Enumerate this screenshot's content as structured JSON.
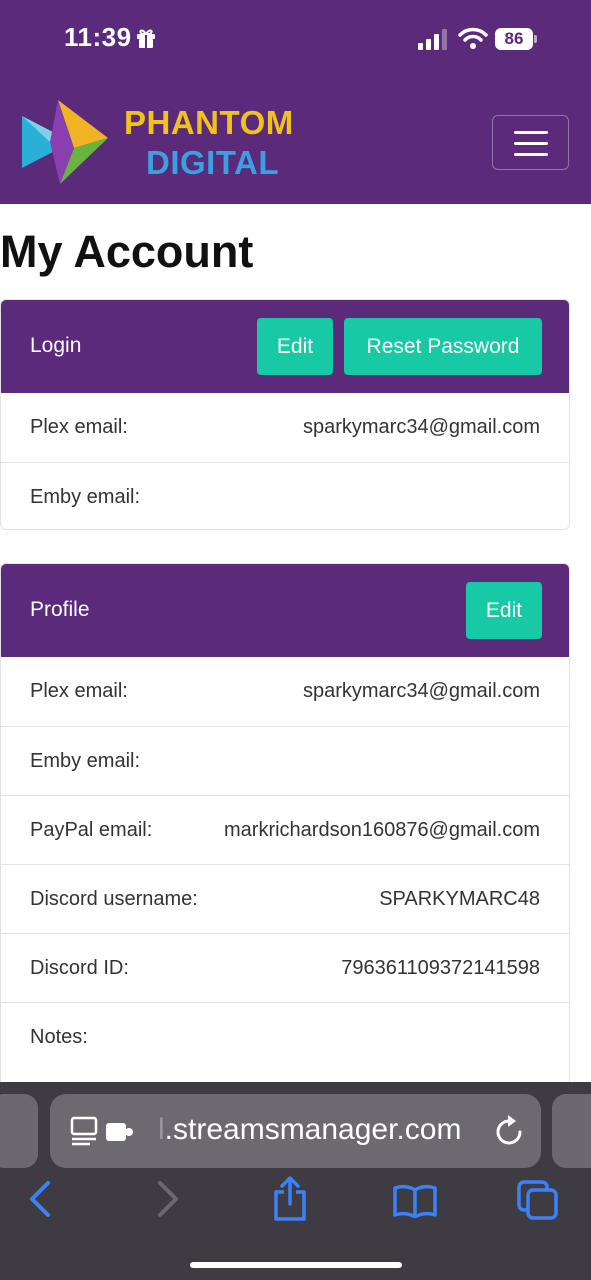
{
  "status_bar": {
    "time": "11:39",
    "battery": "86"
  },
  "brand": {
    "line1": "PHANTOM",
    "line2": "DIGITAL"
  },
  "page": {
    "title": "My Account"
  },
  "login_card": {
    "title": "Login",
    "edit_label": "Edit",
    "reset_label": "Reset Password",
    "rows": [
      {
        "label": "Plex email:",
        "value": "sparkymarc34@gmail.com"
      },
      {
        "label": "Emby email:",
        "value": ""
      }
    ]
  },
  "profile_card": {
    "title": "Profile",
    "edit_label": "Edit",
    "rows": [
      {
        "label": "Plex email:",
        "value": "sparkymarc34@gmail.com"
      },
      {
        "label": "Emby email:",
        "value": ""
      },
      {
        "label": "PayPal email:",
        "value": "markrichardson160876@gmail.com"
      },
      {
        "label": "Discord username:",
        "value": "SPARKYMARC48"
      },
      {
        "label": "Discord ID:",
        "value": "796361109372141598"
      },
      {
        "label": "Notes:",
        "value": ""
      }
    ]
  },
  "browser": {
    "url_prefix": "l",
    "url": ".streamsmanager.com"
  },
  "colors": {
    "brand_purple": "#5b2a7b",
    "button_teal": "#17c9a4",
    "safari_toolbar": "#3e3b42",
    "safari_blue": "#3b82f6"
  },
  "icons": [
    "gift-icon",
    "signal-icon",
    "wifi-icon",
    "battery-icon",
    "menu-icon",
    "reader-icon",
    "extension-icon",
    "reload-icon",
    "back-icon",
    "forward-icon",
    "share-icon",
    "bookmarks-icon",
    "tabs-icon"
  ]
}
